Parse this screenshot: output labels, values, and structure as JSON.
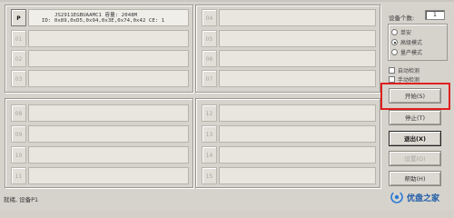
{
  "slots": [
    {
      "label": "P",
      "line1": "JS2911EGBUAAMC1 容量: 2048M",
      "line2": "ID: 0x89,0xD5,0x94,0x3E,0x74,0x42  CE: 1"
    },
    {
      "label": "01",
      "line1": "",
      "line2": ""
    },
    {
      "label": "02",
      "line1": "",
      "line2": ""
    },
    {
      "label": "03",
      "line1": "",
      "line2": ""
    },
    {
      "label": "04",
      "line1": "",
      "line2": ""
    },
    {
      "label": "05",
      "line1": "",
      "line2": ""
    },
    {
      "label": "06",
      "line1": "",
      "line2": ""
    },
    {
      "label": "07",
      "line1": "",
      "line2": ""
    },
    {
      "label": "08",
      "line1": "",
      "line2": ""
    },
    {
      "label": "09",
      "line1": "",
      "line2": ""
    },
    {
      "label": "10",
      "line1": "",
      "line2": ""
    },
    {
      "label": "11",
      "line1": "",
      "line2": ""
    },
    {
      "label": "12",
      "line1": "",
      "line2": ""
    },
    {
      "label": "13",
      "line1": "",
      "line2": ""
    },
    {
      "label": "14",
      "line1": "",
      "line2": ""
    },
    {
      "label": "15",
      "line1": "",
      "line2": ""
    }
  ],
  "controls": {
    "device_count_label": "设备个数:",
    "device_count_value": "1",
    "modes": [
      {
        "label": "单安",
        "selected": false
      },
      {
        "label": "高级模式",
        "selected": true
      },
      {
        "label": "量产模式",
        "selected": false
      }
    ],
    "checks": [
      {
        "label": "自动检测",
        "checked": false
      },
      {
        "label": "手动检测",
        "checked": false
      }
    ],
    "buttons": [
      {
        "label": "开始(S)"
      },
      {
        "label": "停止(T)"
      },
      {
        "label": "退出(X)"
      },
      {
        "label": "设置(O)"
      },
      {
        "label": "帮助(H)"
      }
    ]
  },
  "status_text": "就绪, 设备P1",
  "logo_text": "优盘之家",
  "colors": {
    "window_bg": "#d6d3cc",
    "highlight": "#e02020",
    "logo": "#1c5aa8"
  }
}
